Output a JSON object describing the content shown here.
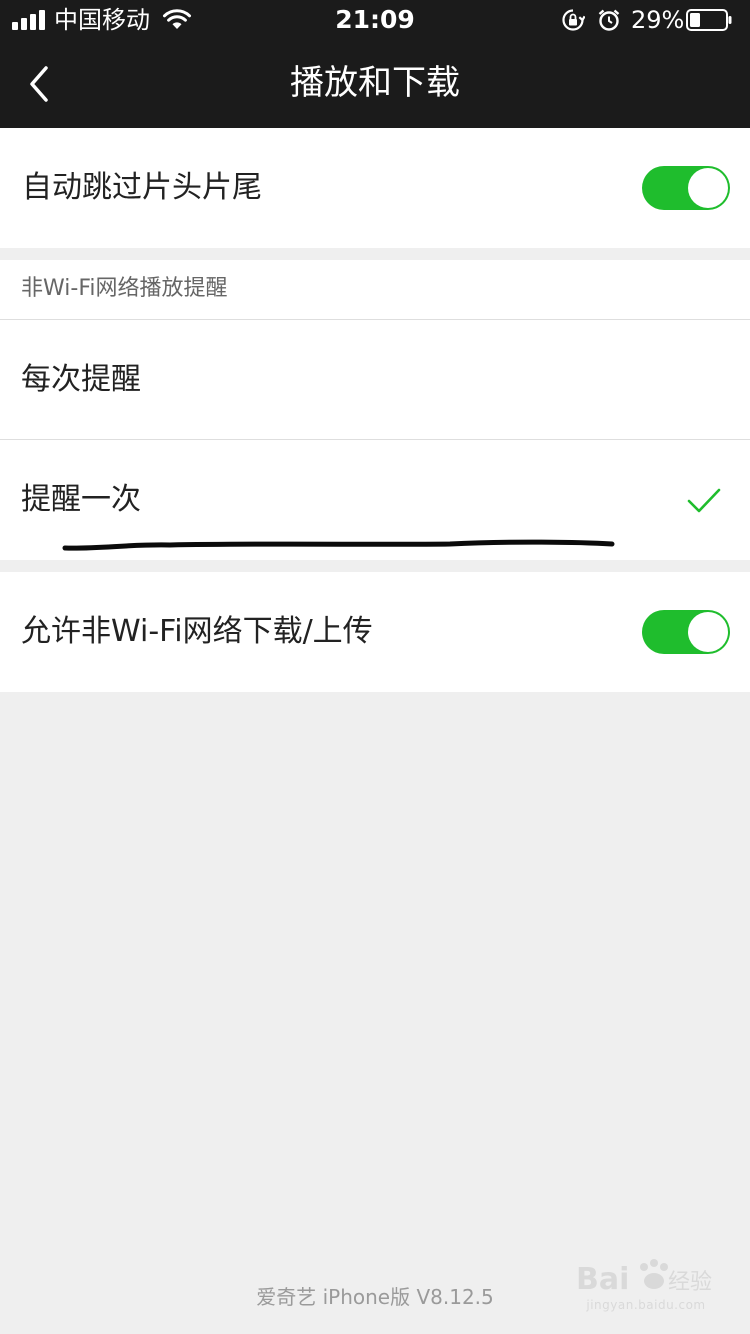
{
  "status_bar": {
    "carrier": "中国移动",
    "time": "21:09",
    "battery_percent": "29%",
    "battery_level": 0.29,
    "icons": [
      "signal-icon",
      "wifi-icon",
      "lock-rotation-icon",
      "alarm-icon",
      "battery-icon"
    ]
  },
  "nav": {
    "title": "播放和下载",
    "back_icon": "chevron-left-icon"
  },
  "settings": {
    "skip_intro": {
      "label": "自动跳过片头片尾",
      "enabled": true
    },
    "wifi_reminder": {
      "header": "非Wi-Fi网络播放提醒",
      "options": [
        {
          "label": "每次提醒",
          "selected": false
        },
        {
          "label": "提醒一次",
          "selected": true
        }
      ]
    },
    "allow_cellular": {
      "label": "允许非Wi-Fi网络下载/上传",
      "enabled": true
    }
  },
  "footer": {
    "version": "爱奇艺 iPhone版 V8.12.5"
  },
  "watermark": {
    "logo_text": "Bai经验",
    "url": "jingyan.baidu.com"
  },
  "colors": {
    "header_bg": "#1b1b1b",
    "toggle_on": "#1fbd2d",
    "check": "#1fbd2d",
    "page_bg": "#efefef"
  }
}
